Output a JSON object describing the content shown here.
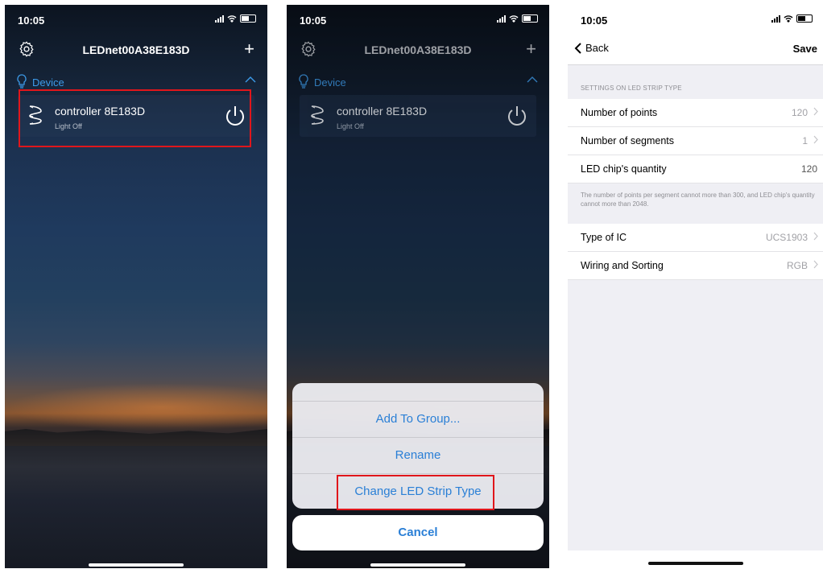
{
  "screen1": {
    "status": {
      "time": "10:05"
    },
    "title": "LEDnet00A38E183D",
    "plus": "+",
    "section": "Device",
    "device": {
      "name": "controller 8E183D",
      "state": "Light Off"
    }
  },
  "screen2": {
    "status": {
      "time": "10:05"
    },
    "title": "LEDnet00A38E183D",
    "plus": "+",
    "section": "Device",
    "device": {
      "name": "controller 8E183D",
      "state": "Light Off"
    },
    "sheet": {
      "items": [
        "Add To Group...",
        "Rename",
        "Change LED Strip Type"
      ],
      "cancel": "Cancel"
    }
  },
  "screen3": {
    "status": {
      "time": "10:05"
    },
    "back": "Back",
    "save": "Save",
    "group_header": "SETTINGS ON LED STRIP TYPE",
    "rows": [
      {
        "label": "Number of points",
        "value": "120"
      },
      {
        "label": "Number of segments",
        "value": "1"
      },
      {
        "label": "LED chip's quantity",
        "value": "120"
      }
    ],
    "note": "The number of points per segment cannot more than 300, and LED chip's quantity cannot  more than 2048.",
    "rows2": [
      {
        "label": "Type of IC",
        "value": "UCS1903"
      },
      {
        "label": "Wiring and Sorting",
        "value": "RGB"
      }
    ]
  },
  "colors": {
    "accent": "#3d9be9",
    "action_blue": "#2a7fd6",
    "highlight_red": "#e0161b"
  }
}
